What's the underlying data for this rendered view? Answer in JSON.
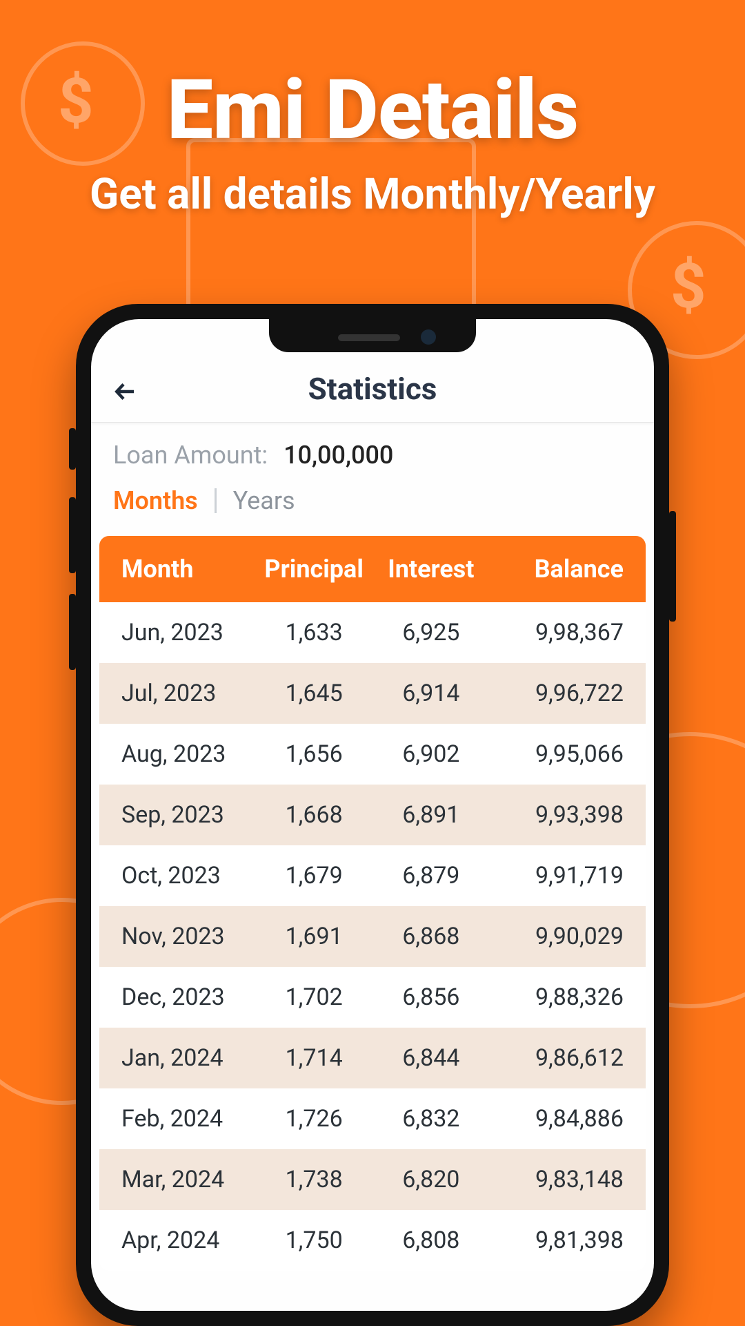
{
  "promo": {
    "title": "Emi Details",
    "subtitle": "Get all details Monthly/Yearly"
  },
  "colors": {
    "accent": "#ff7518"
  },
  "header": {
    "title": "Statistics"
  },
  "loan": {
    "label": "Loan Amount:",
    "value": "10,00,000"
  },
  "tabs": {
    "active": "Months",
    "inactive": "Years"
  },
  "table": {
    "headers": {
      "c1": "Month",
      "c2": "Principal",
      "c3": "Interest",
      "c4": "Balance"
    },
    "rows": [
      {
        "c1": "Jun, 2023",
        "c2": "1,633",
        "c3": "6,925",
        "c4": "9,98,367"
      },
      {
        "c1": "Jul, 2023",
        "c2": "1,645",
        "c3": "6,914",
        "c4": "9,96,722"
      },
      {
        "c1": "Aug, 2023",
        "c2": "1,656",
        "c3": "6,902",
        "c4": "9,95,066"
      },
      {
        "c1": "Sep, 2023",
        "c2": "1,668",
        "c3": "6,891",
        "c4": "9,93,398"
      },
      {
        "c1": "Oct, 2023",
        "c2": "1,679",
        "c3": "6,879",
        "c4": "9,91,719"
      },
      {
        "c1": "Nov, 2023",
        "c2": "1,691",
        "c3": "6,868",
        "c4": "9,90,029"
      },
      {
        "c1": "Dec, 2023",
        "c2": "1,702",
        "c3": "6,856",
        "c4": "9,88,326"
      },
      {
        "c1": "Jan, 2024",
        "c2": "1,714",
        "c3": "6,844",
        "c4": "9,86,612"
      },
      {
        "c1": "Feb, 2024",
        "c2": "1,726",
        "c3": "6,832",
        "c4": "9,84,886"
      },
      {
        "c1": "Mar, 2024",
        "c2": "1,738",
        "c3": "6,820",
        "c4": "9,83,148"
      },
      {
        "c1": "Apr, 2024",
        "c2": "1,750",
        "c3": "6,808",
        "c4": "9,81,398"
      }
    ]
  }
}
